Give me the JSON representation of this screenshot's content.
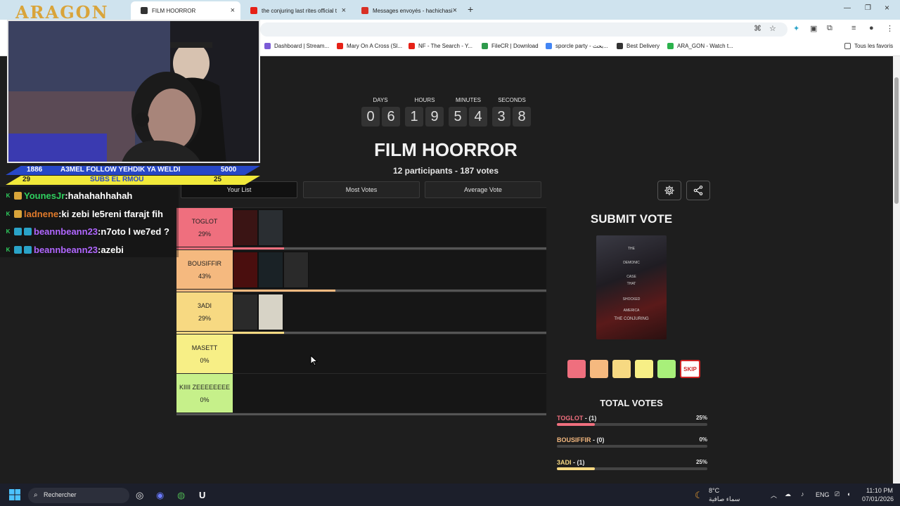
{
  "browser": {
    "tabs": [
      {
        "title": "FILM HOORROR",
        "active": true
      },
      {
        "title": "the conjuring last rites official t",
        "active": false
      },
      {
        "title": "Messages envoyés - hachichasi",
        "active": false
      }
    ],
    "bookmarks": [
      "Dashboard | Stream...",
      "Mary On A Cross (Sl...",
      "NF - The Search - Y...",
      "FileCR | Download",
      "sporcle party - بحث...",
      "Best Delivery",
      "ARA_GON - Watch t..."
    ],
    "all_favorites": "Tous les favoris"
  },
  "overlay": {
    "logo": "ARAGON",
    "info_bar_1": {
      "left": "1886",
      "center": "A3MEL FOLLOW YEHDIK YA WELDI",
      "right": "5000"
    },
    "info_bar_2": {
      "left": "29",
      "center": "SUBS EL RMOU",
      "right": "25"
    },
    "chat": [
      {
        "user": "YounesJr",
        "message": "hahahahhahah",
        "color": "#2fd05f"
      },
      {
        "user": "ladnene",
        "message": "ki zebi le5reni tfarajt fih",
        "color": "#e07a2b"
      },
      {
        "user": "beannbeann23",
        "message": "n7oto l we7ed ?",
        "color": "#b066ff"
      },
      {
        "user": "beannbeann23",
        "message": "azebi",
        "color": "#b066ff"
      }
    ]
  },
  "countdown": {
    "labels": {
      "days": "DAYS",
      "hours": "HOURS",
      "minutes": "MINUTES",
      "seconds": "SECONDS"
    },
    "digits": [
      "0",
      "6",
      "1",
      "9",
      "5",
      "4",
      "3",
      "8"
    ]
  },
  "event": {
    "title": "FILM HOORROR",
    "stats": "12 participants - 187 votes"
  },
  "view_tabs": [
    "Your List",
    "Most Votes",
    "Average Vote"
  ],
  "tiers": [
    {
      "name": "TOGLOT",
      "percent": "29%",
      "pct_value": 0.29,
      "color": "#ef6f7e",
      "posters": 2
    },
    {
      "name": "BOUSIFFIR",
      "percent": "43%",
      "pct_value": 0.43,
      "color": "#f5b97f",
      "posters": 3
    },
    {
      "name": "3ADI",
      "percent": "29%",
      "pct_value": 0.29,
      "color": "#f7d982",
      "posters": 2
    },
    {
      "name": "MASETT",
      "percent": "0%",
      "pct_value": 0,
      "color": "#f7ef86",
      "posters": 0
    },
    {
      "name": "KIIII ZEEEEEEEE",
      "percent": "0%",
      "pct_value": 0,
      "color": "#c6f08a",
      "posters": 0
    }
  ],
  "submit": {
    "title": "SUBMIT VOTE",
    "poster_lines": [
      "THE",
      "DEMONIC",
      "CASE",
      "THAT",
      "SHOCKED",
      "AMERICA",
      "THE CONJURING"
    ],
    "skip_label": "SKIP",
    "swatch_colors": [
      "#ef6f7e",
      "#f5b97f",
      "#f7d982",
      "#f7ef86",
      "#a8f07a"
    ]
  },
  "total_votes": {
    "title": "TOTAL VOTES",
    "rows": [
      {
        "name": "TOGLOT",
        "count": "- (1)",
        "percent": "25%",
        "pct_value": 0.25,
        "color": "#ef6f7e"
      },
      {
        "name": "BOUSIFFIR",
        "count": "- (0)",
        "percent": "0%",
        "pct_value": 0,
        "color": "#f5b97f"
      },
      {
        "name": "3ADI",
        "count": "- (1)",
        "percent": "25%",
        "pct_value": 0.25,
        "color": "#f7d982"
      }
    ]
  },
  "taskbar": {
    "search": "Rechercher",
    "weather_temp": "8°C",
    "weather_desc": "سماء صافية",
    "lang": "ENG",
    "time": "11:10 PM",
    "date": "07/01/2026"
  }
}
